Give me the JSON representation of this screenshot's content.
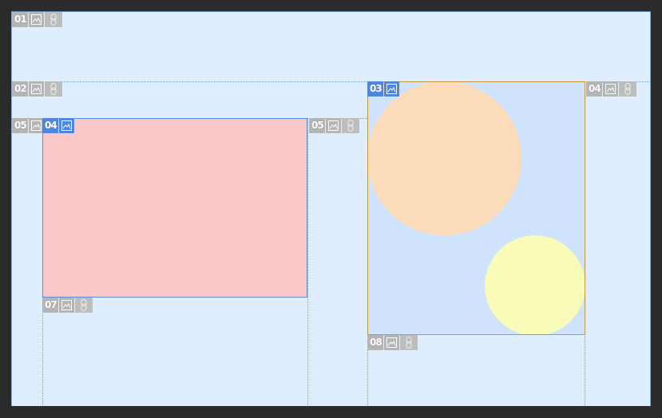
{
  "canvas": {
    "background": "#deeeff",
    "workspace_background": "#2b2b2b"
  },
  "slices": [
    {
      "id": "01",
      "label": "01",
      "type": "auto",
      "icons": [
        "image-icon",
        "link-icon"
      ]
    },
    {
      "id": "02",
      "label": "02",
      "type": "auto",
      "icons": [
        "image-icon",
        "link-icon"
      ]
    },
    {
      "id": "03",
      "label": "03",
      "type": "user",
      "selected": true,
      "icons": [
        "image-icon"
      ],
      "fill": "#cfe4fc",
      "border": "#c9963b"
    },
    {
      "id": "04",
      "label": "04",
      "type": "auto",
      "icons": [
        "image-icon",
        "link-icon"
      ]
    },
    {
      "id": "05",
      "label": "05",
      "type": "auto",
      "icons": [
        "image-icon"
      ]
    },
    {
      "id": "06",
      "label": "04",
      "type": "user",
      "icons": [
        "image-icon"
      ],
      "fill": "#fac8c8",
      "border": "#5b8cd8"
    },
    {
      "id": "07",
      "label": "05",
      "type": "auto",
      "icons": [
        "image-icon",
        "link-icon"
      ]
    },
    {
      "id": "08",
      "label": "07",
      "type": "auto",
      "icons": [
        "image-icon",
        "link-icon"
      ]
    },
    {
      "id": "09",
      "label": "08",
      "type": "auto",
      "icons": [
        "image-icon",
        "link-icon"
      ]
    }
  ],
  "shapes": {
    "peach_circle_color": "#fbdbba",
    "yellow_circle_color": "#f9fbb8"
  }
}
